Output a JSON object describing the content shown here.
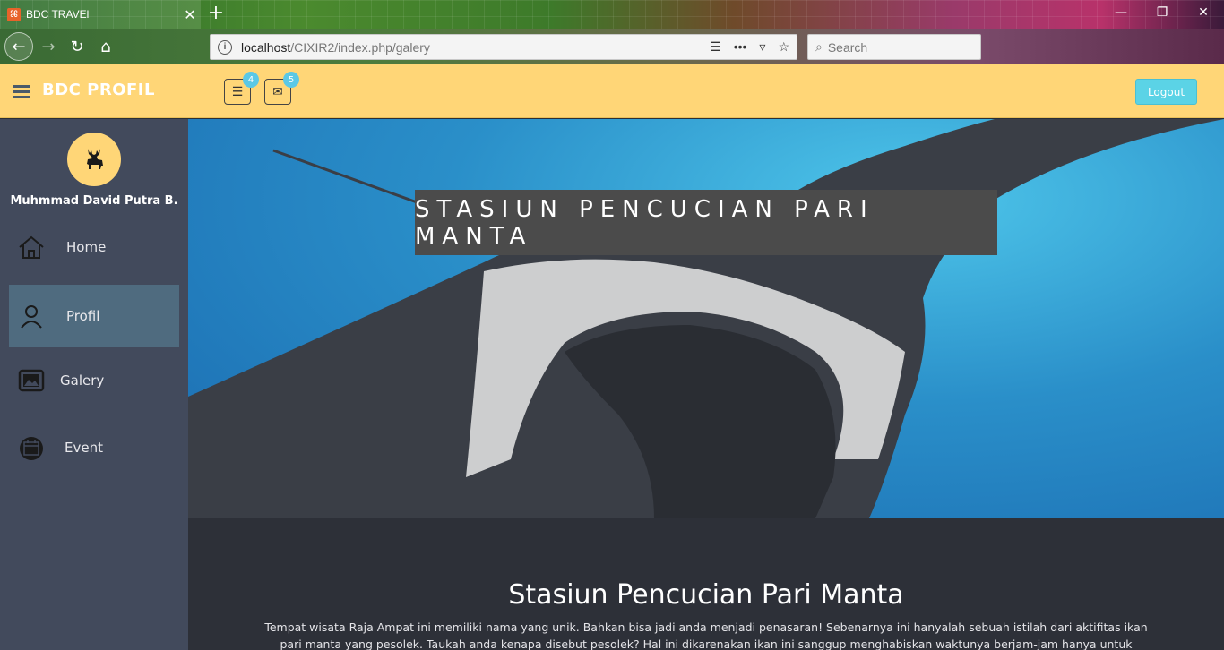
{
  "browser": {
    "tab_title": "BDC TRAVEl",
    "url_host": "localhost",
    "url_path": "/CIXIR2/index.php/galery",
    "search_placeholder": "Search"
  },
  "header": {
    "brand": "BDC PROFIL",
    "tasks_badge": "4",
    "messages_badge": "5",
    "logout_label": "Logout"
  },
  "sidebar": {
    "user_name": "Muhmmad David Putra B.",
    "items": [
      {
        "label": "Home",
        "icon": "home-icon"
      },
      {
        "label": "Profil",
        "icon": "user-icon",
        "active": true
      },
      {
        "label": "Galery",
        "icon": "gallery-icon"
      },
      {
        "label": "Event",
        "icon": "calendar-icon"
      }
    ]
  },
  "hero": {
    "title": "STASIUN PENCUCIAN PARI MANTA"
  },
  "article": {
    "title": "Stasiun Pencucian Pari Manta",
    "body": "Tempat wisata Raja Ampat ini memiliki nama yang unik. Bahkan bisa jadi anda menjadi penasaran! Sebenarnya ini hanyalah sebuah istilah dari aktifitas ikan pari manta yang pesolek. Taukah anda kenapa disebut pesolek? Hal ini dikarenakan ikan ini sanggup menghabiskan waktunya berjam-jam hanya untuk membersihkan diri."
  },
  "colors": {
    "header_bg": "#ffd677",
    "sidebar_bg": "#424a5c",
    "active_item": "#4f6b7f",
    "logout_bg": "#5bd3e6",
    "content_bg": "#2d3038"
  }
}
